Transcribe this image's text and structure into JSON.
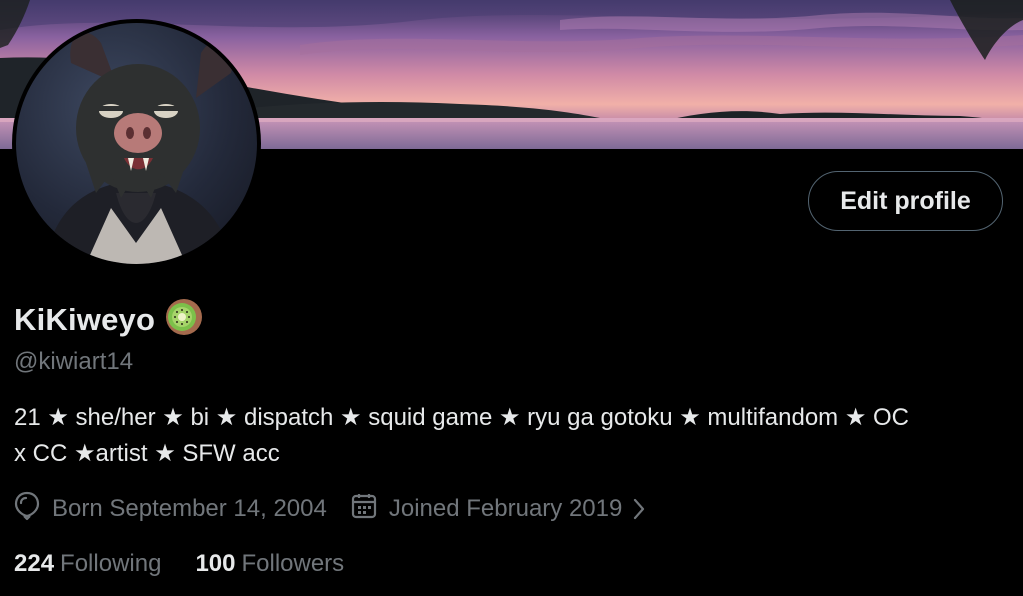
{
  "profile": {
    "display_name": "KiKiweyo",
    "name_emoji": "kiwi-fruit-emoji",
    "handle": "@kiwiart14",
    "bio_line1": "21 ★ she/her ★ bi ★ dispatch ★ squid game ★ ryu ga gotoku ★ multifandom ★ OC",
    "bio_line2": "x CC ★artist ★ SFW acc",
    "birthday": "Born September 14, 2004",
    "joined": "Joined February 2019",
    "following_count": "224",
    "following_label": "Following",
    "followers_count": "100",
    "followers_label": "Followers"
  },
  "actions": {
    "edit_profile": "Edit profile"
  },
  "icons": {
    "birthday": "balloon-icon",
    "joined": "calendar-icon",
    "joined_more": "chevron-right-icon"
  },
  "colors": {
    "background": "#000000",
    "text_primary": "#e7e9ea",
    "text_secondary": "#71767b",
    "button_border": "#536471"
  }
}
